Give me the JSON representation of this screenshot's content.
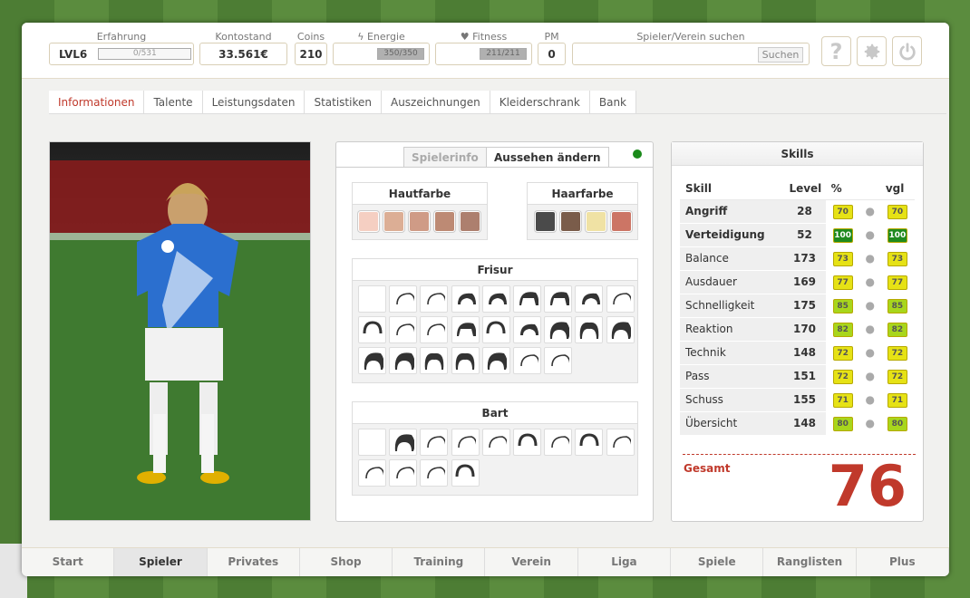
{
  "stats": {
    "experience": {
      "label": "Erfahrung",
      "level": "LVL6",
      "bar": "0/531",
      "fraction": 0
    },
    "balance": {
      "label": "Kontostand",
      "value": "33.561€"
    },
    "coins": {
      "label": "Coins",
      "value": "210"
    },
    "energy": {
      "label": "Energie",
      "bar": "350/350",
      "fraction": 1
    },
    "fitness": {
      "label": "Fitness",
      "bar": "211/211",
      "fraction": 1
    },
    "pm": {
      "label": "PM",
      "value": "0"
    },
    "search": {
      "label": "Spieler/Verein suchen",
      "button": "Suchen"
    }
  },
  "icons": {
    "help": "help-icon",
    "settings": "gear-icon",
    "power": "power-icon"
  },
  "tabs": [
    "Informationen",
    "Talente",
    "Leistungsdaten",
    "Statistiken",
    "Auszeichnungen",
    "Kleiderschrank",
    "Bank"
  ],
  "look": {
    "tab_info": "Spielerinfo",
    "tab_look": "Aussehen ändern",
    "skin": {
      "title": "Hautfarbe",
      "colors": [
        "#f5cfc2",
        "#dcae95",
        "#cf9b86",
        "#bd8a74",
        "#ad7f6e",
        "#8d6a59"
      ]
    },
    "hair": {
      "title": "Haarfarbe",
      "colors": [
        "#4a4a4a",
        "#7a5c4a",
        "#f0e2a4",
        "#cc7565"
      ]
    },
    "hairstyle": {
      "title": "Frisur"
    },
    "beard": {
      "title": "Bart"
    }
  },
  "skills": {
    "title": "Skills",
    "headers": {
      "skill": "Skill",
      "level": "Level",
      "pct": "%",
      "cmp": "vgl"
    },
    "rows": [
      {
        "name": "Angriff",
        "level": "28",
        "pct": "70",
        "cmp": "70",
        "bold": true,
        "color": "#e6e215"
      },
      {
        "name": "Verteidigung",
        "level": "52",
        "pct": "100",
        "cmp": "100",
        "bold": true,
        "color": "#1f8a1f"
      },
      {
        "name": "Balance",
        "level": "173",
        "pct": "73",
        "cmp": "73",
        "bold": false,
        "color": "#e6e215"
      },
      {
        "name": "Ausdauer",
        "level": "169",
        "pct": "77",
        "cmp": "77",
        "bold": false,
        "color": "#e6e215"
      },
      {
        "name": "Schnelligkeit",
        "level": "175",
        "pct": "85",
        "cmp": "85",
        "bold": false,
        "color": "#a8d61c"
      },
      {
        "name": "Reaktion",
        "level": "170",
        "pct": "82",
        "cmp": "82",
        "bold": false,
        "color": "#a8d61c"
      },
      {
        "name": "Technik",
        "level": "148",
        "pct": "72",
        "cmp": "72",
        "bold": false,
        "color": "#e6e215"
      },
      {
        "name": "Pass",
        "level": "151",
        "pct": "72",
        "cmp": "72",
        "bold": false,
        "color": "#e6e215"
      },
      {
        "name": "Schuss",
        "level": "155",
        "pct": "71",
        "cmp": "71",
        "bold": false,
        "color": "#e6e215"
      },
      {
        "name": "Übersicht",
        "level": "148",
        "pct": "80",
        "cmp": "80",
        "bold": false,
        "color": "#a8d61c"
      }
    ],
    "total_label": "Gesamt",
    "total_value": "76"
  },
  "bottom_nav": [
    "Start",
    "Spieler",
    "Privates",
    "Shop",
    "Training",
    "Verein",
    "Liga",
    "Spiele",
    "Ranglisten",
    "Plus"
  ]
}
